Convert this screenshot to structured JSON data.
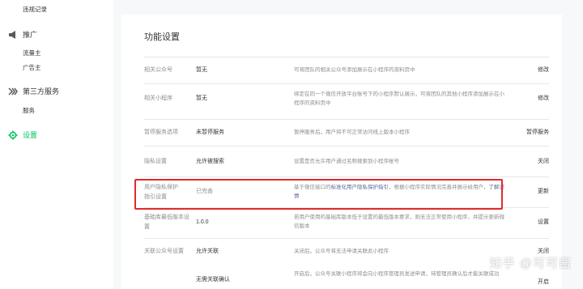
{
  "sidebar": {
    "top_item": "违规记录",
    "promo": {
      "title": "推广",
      "items": [
        "流量主",
        "广告主"
      ]
    },
    "third": {
      "title": "第三方服务",
      "items": [
        "服务"
      ]
    },
    "settings": {
      "title": "设置"
    }
  },
  "main": {
    "title": "功能设置",
    "rows": [
      {
        "label": "相关公众号",
        "value": "暂无",
        "desc": "可将团队的相关公众号添加展示在小程序的资料页中",
        "action": "修改"
      },
      {
        "label": "相关小程序",
        "value": "暂无",
        "desc": "绑定在同一个微信开放平台账号下的小程序默认展示，可将团队的其他小程序添加展示在小程序的资料页中",
        "action": "修改"
      },
      {
        "label": "暂停服务选项",
        "value": "未暂停服务",
        "desc": "暂停服务后，用户将不可正常访问线上版本小程序",
        "action": "暂停服务"
      },
      {
        "label": "隐私设置",
        "value": "允许被搜索",
        "desc": "设置是否允许用户通过名称搜索到小程序帐号",
        "action": "关闭"
      },
      {
        "label": "用户隐私保护指引设置",
        "value": "已完善",
        "desc_pre": "基于微信接口的",
        "desc_link": "标准化用户隐私保护指引",
        "desc_mid": "，根据小程序实际情况完善并展示给用户，",
        "desc_link2": "了解详情",
        "action": "更新"
      },
      {
        "label": "基础库最低版本设置",
        "value": "1.0.0",
        "desc": "若用户使用的基础库版本低于设置的最低版本要求，则无法正常使用小程序，并提示更新微信版本",
        "action": "设置"
      },
      {
        "label": "关联公众号设置",
        "value": "允许关联",
        "desc": "关闭后，公众号将无法申请关联此小程序",
        "action": "关闭"
      },
      {
        "label": "",
        "value": "无需关联确认",
        "desc": "开启后，公众号关联小程序将会向小程序管理员发送申请，待管理员确认后才能关联成功",
        "action": "开启"
      }
    ]
  },
  "watermark": "知乎 @可可酱",
  "colors": {
    "accent": "#07c160",
    "highlight": "#e02b2b",
    "link": "#576b95"
  }
}
